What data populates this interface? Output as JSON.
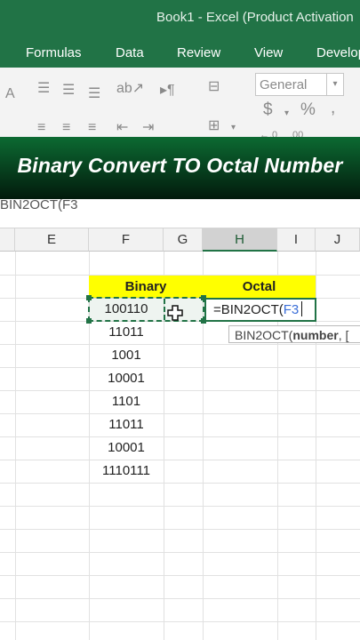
{
  "window": {
    "title": "Book1 - Excel (Product Activation"
  },
  "ribbon_tabs": [
    "Formulas",
    "Data",
    "Review",
    "View",
    "Develop"
  ],
  "ribbon": {
    "number_format": "General",
    "currency_symbol": "$",
    "percent_symbol": "%",
    "comma_symbol": ","
  },
  "banner": {
    "text": "Binary Convert TO Octal Number"
  },
  "formula_bar": {
    "text": "BIN2OCT(F3"
  },
  "columns": [
    "E",
    "F",
    "G",
    "H",
    "I",
    "J"
  ],
  "selected_column": "H",
  "table": {
    "headers": {
      "binary": "Binary",
      "octal": "Octal"
    },
    "binary_values": [
      "100110",
      "11011",
      "1001",
      "10001",
      "1101",
      "11011",
      "10001",
      "1110111"
    ]
  },
  "edit_cell": {
    "prefix": "=BIN2OCT(",
    "ref": "F3"
  },
  "tooltip": {
    "fn": "BIN2OCT(",
    "arg": "number",
    "rest": ", ["
  },
  "colors": {
    "excel_green": "#217346",
    "header_yellow": "#ffff00",
    "ref_blue": "#3b6fd8"
  }
}
